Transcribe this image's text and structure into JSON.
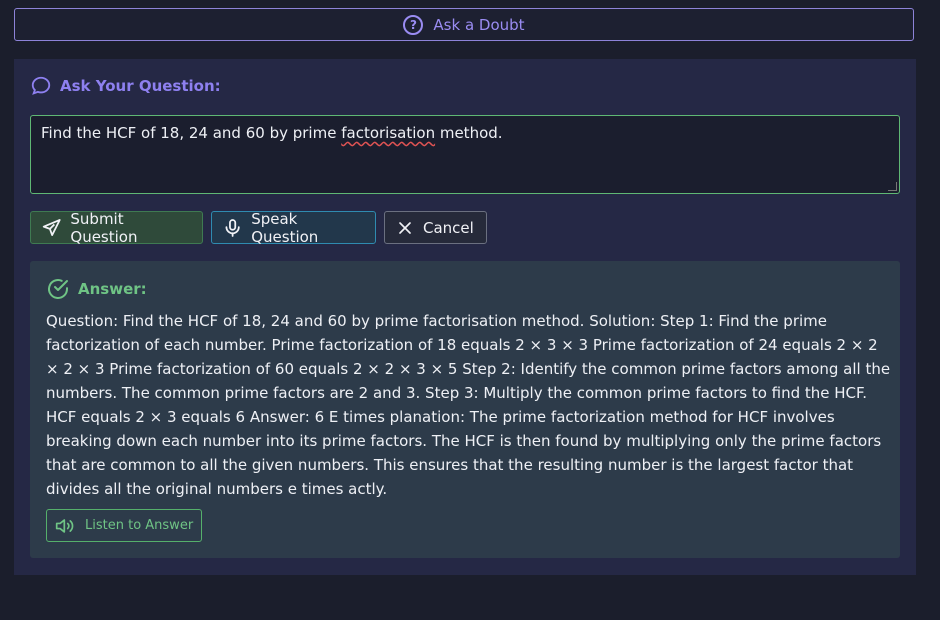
{
  "ask_doubt": {
    "label": "Ask a Doubt",
    "icon": "question-circle-icon"
  },
  "question_panel": {
    "heading": "Ask Your Question:",
    "input_value_prefix": "Find the HCF of 18, 24 and 60 by prime ",
    "input_value_flagged": "factorisation",
    "input_value_suffix": " method."
  },
  "buttons": {
    "submit": "Submit Question",
    "speak": "Speak Question",
    "cancel": "Cancel"
  },
  "answer": {
    "heading": "Answer:",
    "text": "Question: Find the HCF of 18, 24 and 60 by prime factorisation method. Solution: Step 1: Find the prime factorization of each number. Prime factorization of 18 equals 2 × 3 × 3 Prime factorization of 24 equals 2 × 2 × 2 × 3 Prime factorization of 60 equals 2 × 2 × 3 × 5 Step 2: Identify the common prime factors among all the numbers. The common prime factors are 2 and 3. Step 3: Multiply the common prime factors to find the HCF. HCF equals 2 × 3 equals 6 Answer: 6 E times planation: The prime factorization method for HCF involves breaking down each number into its prime factors. The HCF is then found by multiplying only the prime factors that are common to all the given numbers. This ensures that the resulting number is the largest factor that divides all the original numbers e times actly.",
    "listen_label": "Listen to Answer"
  },
  "colors": {
    "accent_purple": "#9a8cf2",
    "accent_green": "#6fc485",
    "background": "#1b1e2c",
    "panel": "#252845"
  }
}
